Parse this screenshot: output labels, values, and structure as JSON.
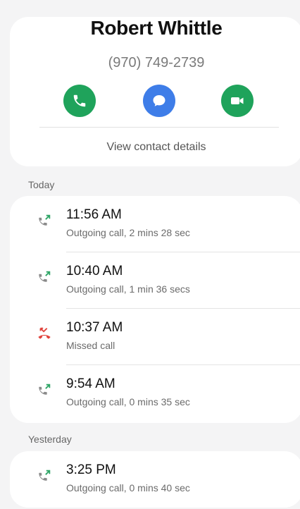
{
  "contact": {
    "name": "Robert Whittle",
    "phone": "(970) 749-2739",
    "view_details_label": "View contact details"
  },
  "actions": [
    {
      "icon": "phone-icon",
      "color": "#1fa35b"
    },
    {
      "icon": "message-icon",
      "color": "#3e7de8"
    },
    {
      "icon": "video-icon",
      "color": "#1fa35b"
    }
  ],
  "sections": {
    "today": {
      "label": "Today",
      "items": [
        {
          "time": "11:56 AM",
          "description": "Outgoing call, 2 mins 28 sec",
          "type": "outgoing"
        },
        {
          "time": "10:40 AM",
          "description": "Outgoing call, 1 min 36 secs",
          "type": "outgoing"
        },
        {
          "time": "10:37 AM",
          "description": "Missed call",
          "type": "missed"
        },
        {
          "time": "9:54 AM",
          "description": "Outgoing call, 0 mins 35 sec",
          "type": "outgoing"
        }
      ]
    },
    "yesterday": {
      "label": "Yesterday",
      "items": [
        {
          "time": "3:25 PM",
          "description": "Outgoing call, 0 mins 40 sec",
          "type": "outgoing"
        }
      ]
    }
  },
  "colors": {
    "outgoing_arrow": "#2ea566",
    "missed": "#e0413a",
    "handset_gray": "#8a8a8a"
  }
}
